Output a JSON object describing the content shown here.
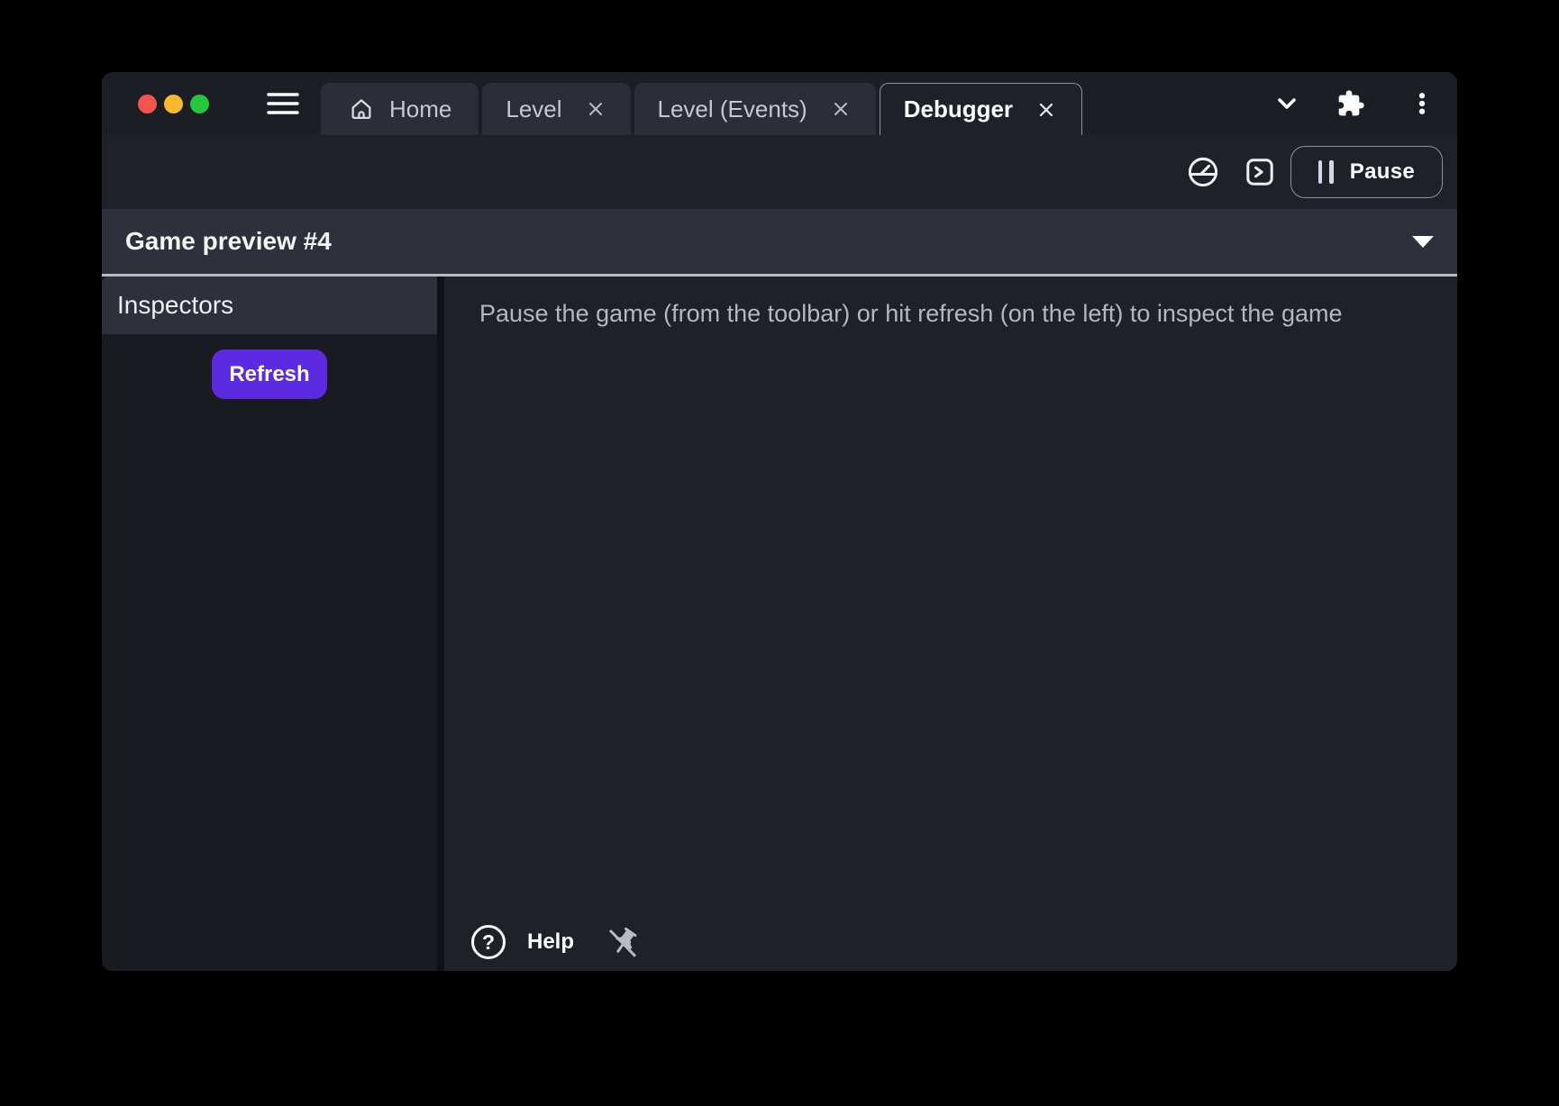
{
  "titlebar": {
    "tabs": [
      {
        "label": "Home"
      },
      {
        "label": "Level"
      },
      {
        "label": "Level (Events)"
      },
      {
        "label": "Debugger"
      }
    ]
  },
  "toolbar": {
    "pause_label": "Pause"
  },
  "preview": {
    "title": "Game preview #4"
  },
  "sidebar": {
    "title": "Inspectors",
    "refresh_label": "Refresh"
  },
  "main": {
    "message": "Pause the game (from the toolbar) or hit refresh (on the left) to inspect the game",
    "help_label": "Help"
  },
  "icons": {
    "help_glyph": "?"
  },
  "colors": {
    "accent_purple": "#5c2be1",
    "traffic_red": "#f4544f",
    "traffic_yellow": "#f9b82d",
    "traffic_green": "#27c63f",
    "divider_light": "#b9bbc4"
  }
}
